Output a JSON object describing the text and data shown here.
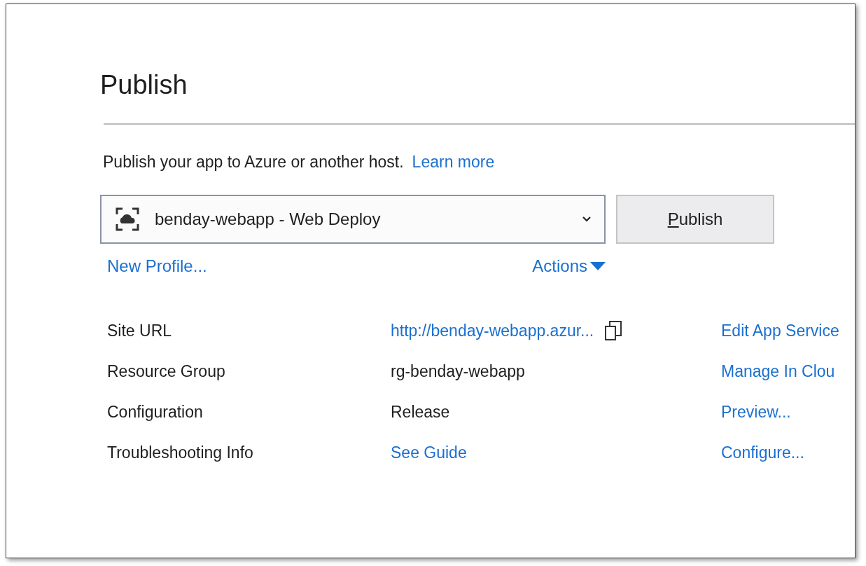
{
  "title": "Publish",
  "intro": {
    "text": "Publish your app to Azure or another host.",
    "link": "Learn more"
  },
  "profile": {
    "value": "benday-webapp - Web Deploy"
  },
  "publish_button": {
    "label": "Publish",
    "first_letter_underlined": true
  },
  "links": {
    "new_profile": "New Profile...",
    "actions": "Actions"
  },
  "details": [
    {
      "label": "Site URL",
      "value": "http://benday-webapp.azur...",
      "kind": "link-copy",
      "action": "Edit App Service"
    },
    {
      "label": "Resource Group",
      "value": "rg-benday-webapp",
      "kind": "text",
      "action": "Manage In Clou"
    },
    {
      "label": "Configuration",
      "value": "Release",
      "kind": "text",
      "action": "Preview..."
    },
    {
      "label": "Troubleshooting Info",
      "value": "See Guide",
      "kind": "link",
      "action": "Configure..."
    }
  ]
}
